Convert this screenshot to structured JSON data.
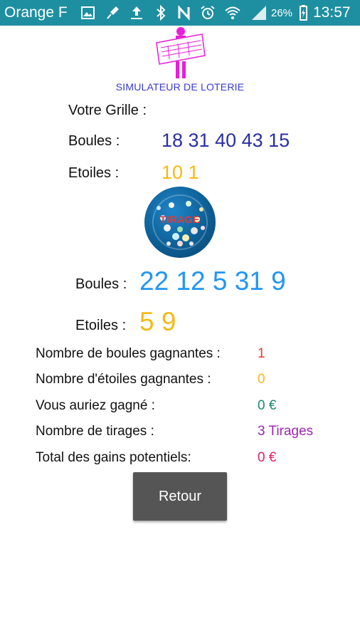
{
  "status_bar": {
    "carrier": "Orange F",
    "battery_percent": "26%",
    "time": "13:57",
    "icons": [
      "image-icon",
      "microphone-icon",
      "upload-icon",
      "bluetooth-icon",
      "nfc-icon",
      "alarm-icon",
      "wifi-icon",
      "signal-icon",
      "battery-charging-icon"
    ]
  },
  "app": {
    "title": "SIMULATEUR DE LOTERIE",
    "logo_icon": "lottery-person-ticket-icon",
    "accent_magenta": "#e91ed8",
    "statusbar_color": "#1e8fa0"
  },
  "grid": {
    "heading": "Votre Grille :",
    "balls_label": "Boules :",
    "balls": "18 31 40 43 15",
    "stars_label": "Etoiles :",
    "stars": "10 1"
  },
  "draw_button": {
    "label": "TIRAGE",
    "icon": "lottery-drum-icon"
  },
  "draw_result": {
    "balls_label": "Boules :",
    "balls": "22 12 5 31 9",
    "stars_label": "Etoiles :",
    "stars": "5 9"
  },
  "stats": [
    {
      "label": "Nombre de boules gagnantes :",
      "value": "1",
      "color": "#e53935"
    },
    {
      "label": "Nombre d'étoiles  gagnantes :",
      "value": "0",
      "color": "#f5b915"
    },
    {
      "label": "Vous auriez gagné :",
      "value": "0 €",
      "color": "#1a8a6e"
    },
    {
      "label": "Nombre de tirages :",
      "value": "3  Tirages",
      "color": "#9c27b0"
    },
    {
      "label": "Total des gains potentiels:",
      "value": "0  €",
      "color": "#e91e63"
    }
  ],
  "back_button": {
    "label": "Retour"
  }
}
